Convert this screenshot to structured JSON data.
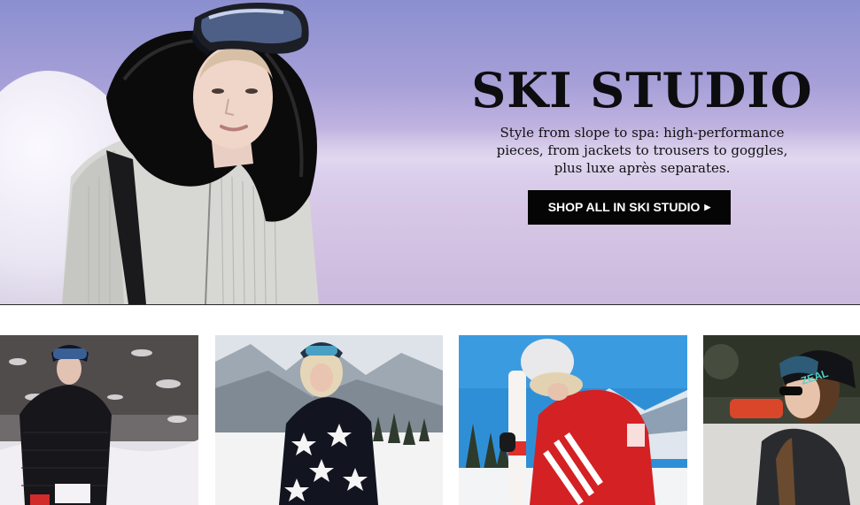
{
  "hero": {
    "title": "SKI STUDIO",
    "subtitle": "Style from slope to spa: high-performance pieces, from jackets to trousers to goggles, plus luxe après separates.",
    "cta_label": "SHOP ALL IN SKI STUDIO",
    "cta_icon": "chevron-right-icon"
  },
  "tiles": [
    {
      "name": "product-tile-black-quilted-ski-jacket"
    },
    {
      "name": "product-tile-star-print-ski-suit"
    },
    {
      "name": "product-tile-red-striped-ski-jacket"
    },
    {
      "name": "product-tile-black-performance-jacket"
    }
  ],
  "colors": {
    "cta_background": "#050505",
    "cta_text": "#ffffff",
    "title_text": "#0d0d10",
    "hero_sky": "#8b8fd0"
  }
}
